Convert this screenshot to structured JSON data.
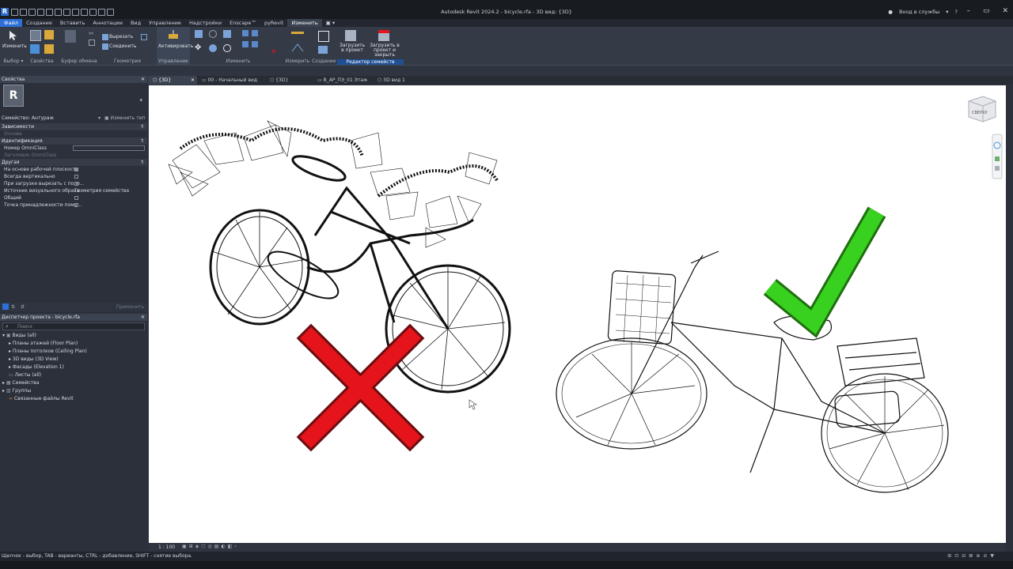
{
  "title_bar": {
    "app_icon": "R",
    "window_title": "Autodesk Revit 2024.2 - bicycle.rfa - 3D вид: {3D}",
    "signin": "Вход в службы",
    "help": "?"
  },
  "menu": {
    "items": [
      "Файл",
      "Создание",
      "Вставить",
      "Аннотации",
      "Вид",
      "Управление",
      "Надстройки",
      "Enscape™",
      "pyRevit",
      "Изменить"
    ]
  },
  "ribbon": {
    "modify_label": "Изменить",
    "cut_label": "Вырезать",
    "join_label": "Соединить",
    "activate_label": "Активировать",
    "load_to_project": "Загрузить в проект",
    "load_to_project_close": "Загрузить в проект и закрыть",
    "groups": [
      "Выбор",
      "Свойства",
      "Буфер обмена",
      "Геометрия",
      "Управление",
      "Изменить",
      "Измерить",
      "Создание",
      "Редактор семейств"
    ]
  },
  "properties": {
    "header": "Свойства",
    "family_label": "Семейство: Антураж",
    "edit_type": "Изменить тип",
    "apply": "Применить",
    "cat_constraints": "Зависимости",
    "base_label": "Основа",
    "cat_identity": "Идентификация",
    "omniclass_number": "Номер OmniClass",
    "omniclass_title": "Заголовок OmniClass",
    "cat_other": "Другая",
    "rows": [
      {
        "label": "На основе рабочей плоскости",
        "checked": true
      },
      {
        "label": "Всегда вертикально",
        "checked": false
      },
      {
        "label": "При загрузке вырезать с поло...",
        "checked": false
      },
      {
        "label": "Источник визуального образа",
        "value": "Геометрия семейства"
      },
      {
        "label": "Общий",
        "checked": false
      },
      {
        "label": "Точка принадлежности поме...",
        "checked": false
      }
    ]
  },
  "project_browser": {
    "header": "Диспетчер проекта - bicycle.rfa",
    "search_placeholder": "Поиск",
    "tree": [
      {
        "label": "Виды (all)",
        "level": 0,
        "expanded": true
      },
      {
        "label": "Планы этажей (Floor Plan)",
        "level": 1
      },
      {
        "label": "Планы потолков (Ceiling Plan)",
        "level": 1
      },
      {
        "label": "3D виды (3D View)",
        "level": 1
      },
      {
        "label": "Фасады (Elevation 1)",
        "level": 1
      },
      {
        "label": "Листы (all)",
        "level": 0
      },
      {
        "label": "Семейства",
        "level": 0
      },
      {
        "label": "Группы",
        "level": 0
      },
      {
        "label": "Связанные файлы Revit",
        "level": 0
      }
    ]
  },
  "view_tabs": [
    "{3D}",
    "00 - Начальный вид",
    "{3D}",
    "В_АР_ПЭ_01 Этаж",
    "3D вид 1"
  ],
  "viewcube_label": "СВЕРХУ",
  "view_bar": {
    "scale": "1 : 100"
  },
  "status_bar": {
    "text": "Щелчок - выбор, TAB - варианты, CTRL - добавление, SHIFT - снятие выбора."
  },
  "colors": {
    "accent": "#2d6fd6",
    "cross": "#e5141b",
    "check": "#39d11f"
  }
}
